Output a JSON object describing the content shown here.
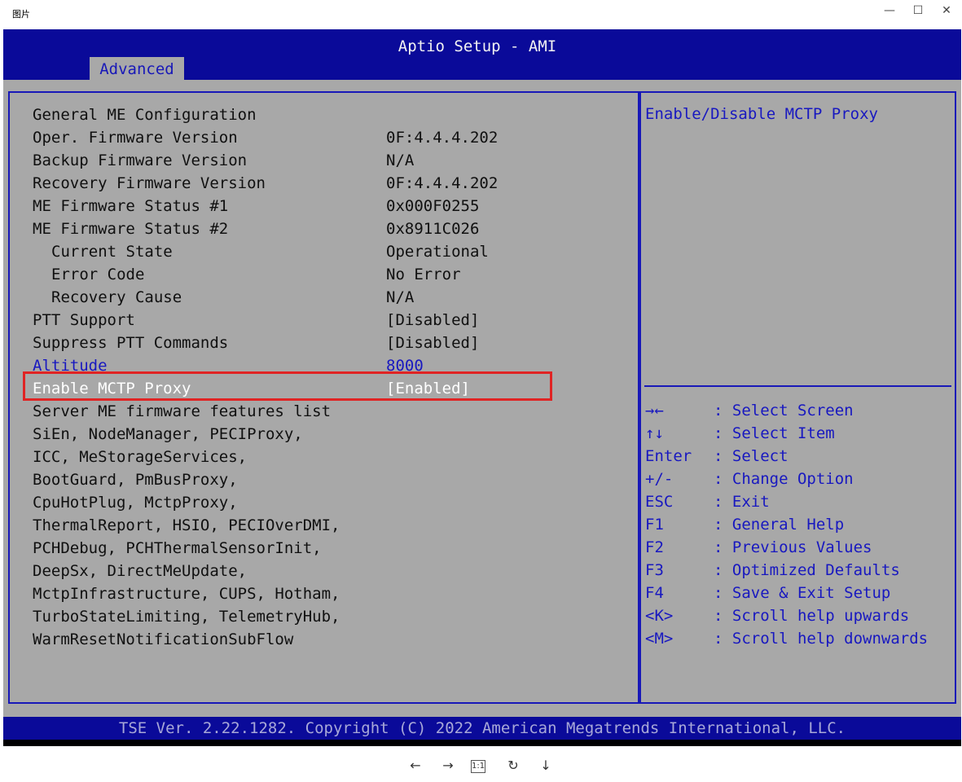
{
  "window": {
    "title": "图片",
    "minimize": "—",
    "maximize": "☐",
    "close": "✕"
  },
  "bios": {
    "title": "Aptio Setup - AMI",
    "tab": "Advanced",
    "rows": [
      {
        "label": "General ME Configuration",
        "value": ""
      },
      {
        "label": "Oper. Firmware Version",
        "value": "0F:4.4.4.202"
      },
      {
        "label": "Backup Firmware Version",
        "value": "N/A"
      },
      {
        "label": "Recovery Firmware Version",
        "value": "0F:4.4.4.202"
      },
      {
        "label": "ME Firmware Status #1",
        "value": "0x000F0255"
      },
      {
        "label": "ME Firmware Status #2",
        "value": "0x8911C026"
      },
      {
        "label": "Current State",
        "value": "Operational"
      },
      {
        "label": "Error Code",
        "value": "No Error"
      },
      {
        "label": "Recovery Cause",
        "value": "N/A"
      },
      {
        "label": "PTT Support",
        "value": "[Disabled]"
      },
      {
        "label": "Suppress PTT Commands",
        "value": "[Disabled]"
      },
      {
        "label": "Altitude",
        "value": "8000"
      },
      {
        "label": "Enable MCTP Proxy",
        "value": "[Enabled]"
      }
    ],
    "features_lines": [
      "Server ME firmware features list",
      "SiEn, NodeManager, PECIProxy,",
      "ICC, MeStorageServices,",
      "BootGuard, PmBusProxy,",
      "CpuHotPlug, MctpProxy,",
      "ThermalReport, HSIO, PECIOverDMI,",
      "PCHDebug, PCHThermalSensorInit,",
      "DeepSx, DirectMeUpdate,",
      "MctpInfrastructure, CUPS, Hotham,",
      "TurboStateLimiting, TelemetryHub,",
      "WarmResetNotificationSubFlow"
    ],
    "help_text": "Enable/Disable MCTP Proxy",
    "keys": [
      {
        "key": "→←",
        "desc": ": Select Screen"
      },
      {
        "key": "↑↓",
        "desc": ": Select Item"
      },
      {
        "key": "Enter",
        "desc": ": Select"
      },
      {
        "key": "+/-",
        "desc": ": Change Option"
      },
      {
        "key": "ESC",
        "desc": ": Exit"
      },
      {
        "key": "F1",
        "desc": ": General Help"
      },
      {
        "key": "F2",
        "desc": ": Previous Values"
      },
      {
        "key": "F3",
        "desc": ": Optimized Defaults"
      },
      {
        "key": "F4",
        "desc": ": Save & Exit Setup"
      },
      {
        "key": "<K>",
        "desc": ": Scroll help upwards"
      },
      {
        "key": "<M>",
        "desc": ": Scroll help downwards"
      }
    ],
    "footer": "TSE Ver. 2.22.1282. Copyright (C) 2022 American Megatrends International, LLC.",
    "colors": {
      "header": "#0a0a99",
      "panel": "#a8a8a8",
      "accent": "#1818c0",
      "highlight_box": "#e02424"
    }
  },
  "viewer": {
    "prev": "←",
    "next": "→",
    "actual_size": "1:1",
    "rotate": "↻",
    "download": "↓"
  }
}
